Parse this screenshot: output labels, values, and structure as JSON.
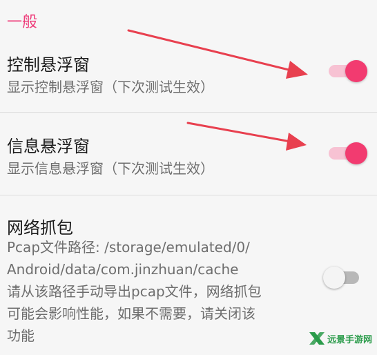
{
  "section": {
    "title": "一般"
  },
  "prefs": [
    {
      "title": "控制悬浮窗",
      "summary": "显示控制悬浮窗（下次测试生效）",
      "enabled": true
    },
    {
      "title": "信息悬浮窗",
      "summary": "显示信息悬浮窗（下次测试生效）",
      "enabled": true
    },
    {
      "title": "网络抓包",
      "summary_lines": [
        "Pcap文件路径: /storage/emulated/0/",
        "Android/data/com.jinzhuan/cache",
        "请从该路径手动导出pcap文件，网络抓包",
        "可能会影响性能，如果不需要，请关闭该",
        "功能"
      ],
      "enabled": false
    }
  ],
  "colors": {
    "accent": "#f23b70",
    "accent_track": "#f7c2d3",
    "header": "#ee3d7a",
    "annotation_arrow": "#e8404f",
    "watermark": "#2a9b4a"
  },
  "watermark": {
    "text": "远景手游网",
    "icon": "x-logo-icon"
  }
}
